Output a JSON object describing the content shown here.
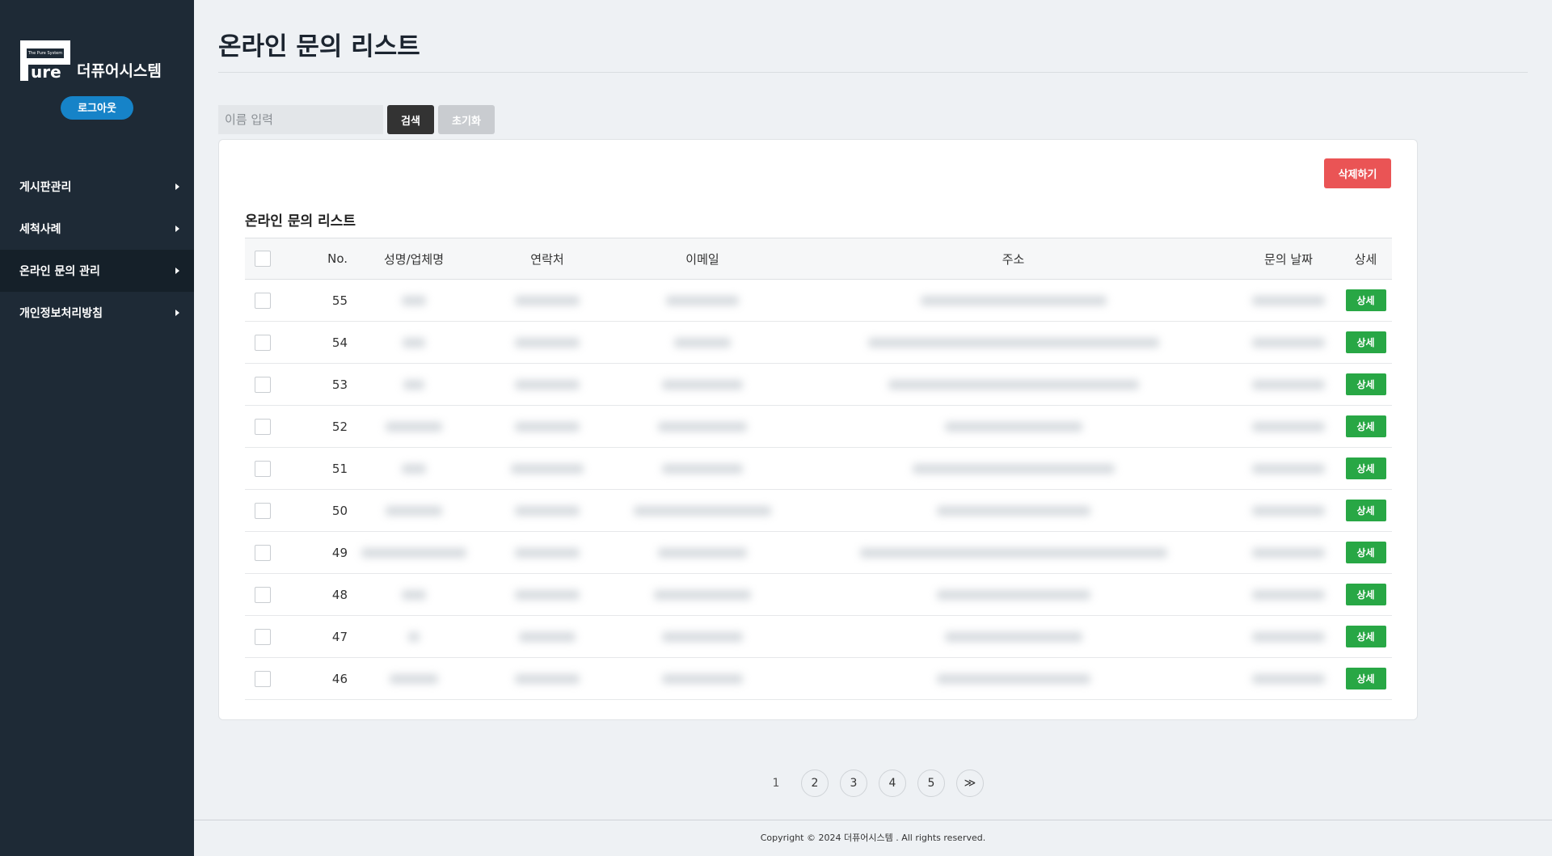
{
  "brand": {
    "logo_tagline": "The Pure System",
    "logo_word": "ure",
    "name": "더퓨어시스템",
    "logout_label": "로그아웃"
  },
  "sidebar": {
    "items": [
      {
        "label": "게시판관리",
        "active": false
      },
      {
        "label": "세척사례",
        "active": false
      },
      {
        "label": "온라인 문의 관리",
        "active": true
      },
      {
        "label": "개인정보처리방침",
        "active": false
      }
    ]
  },
  "main": {
    "title": "온라인 문의 리스트",
    "search": {
      "placeholder": "이름 입력",
      "value": "",
      "search_label": "검색",
      "reset_label": "초기화"
    },
    "delete_label": "삭제하기",
    "panel_title": "온라인 문의 리스트",
    "columns": [
      "No.",
      "성명/업체명",
      "연락처",
      "이메일",
      "주소",
      "문의 날짜",
      "상세"
    ],
    "detail_label": "상세",
    "rows": [
      {
        "no": "55"
      },
      {
        "no": "54"
      },
      {
        "no": "53"
      },
      {
        "no": "52"
      },
      {
        "no": "51"
      },
      {
        "no": "50"
      },
      {
        "no": "49"
      },
      {
        "no": "48"
      },
      {
        "no": "47"
      },
      {
        "no": "46"
      }
    ]
  },
  "pagination": {
    "pages": [
      "1",
      "2",
      "3",
      "4",
      "5"
    ],
    "current": "1",
    "next_label": "≫"
  },
  "footer": {
    "copyright": "Copyright © 2024 더퓨어시스템 . All rights reserved."
  },
  "colors": {
    "sidebar_bg": "#1e2a36",
    "logout_blue": "#1683c8",
    "delete_red": "#ea5455",
    "detail_green": "#28a745"
  }
}
